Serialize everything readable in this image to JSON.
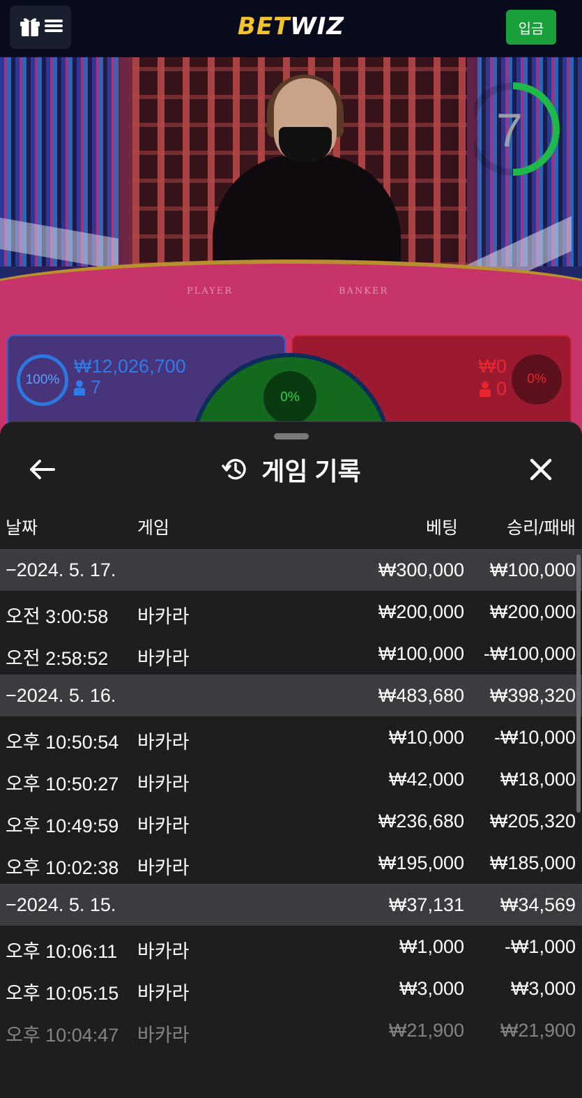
{
  "header": {
    "logo_part1": "BET",
    "logo_part2": "WIZ",
    "deposit_label": "입금",
    "menu_icons": [
      "gift-icon",
      "hamburger-menu-icon"
    ]
  },
  "game": {
    "countdown": "7",
    "player": {
      "percent": "100%",
      "amount": "₩12,026,700",
      "count": "7"
    },
    "tie": {
      "percent": "0%"
    },
    "banker": {
      "percent": "0%",
      "amount": "₩0",
      "count": "0"
    },
    "table_text_left": "PLAYER",
    "table_text_right": "BANKER"
  },
  "history": {
    "title": "게임 기록",
    "columns": {
      "date": "날짜",
      "game": "게임",
      "bet": "베팅",
      "win": "승리/패배"
    },
    "groups": [
      {
        "date": "−2024. 5. 17.",
        "bet": "₩300,000",
        "win": "₩100,000",
        "rows": [
          {
            "time": "오전 3:00:58",
            "game": "바카라",
            "bet": "₩200,000",
            "win": "₩200,000"
          },
          {
            "time": "오전 2:58:52",
            "game": "바카라",
            "bet": "₩100,000",
            "win": "-₩100,000"
          }
        ]
      },
      {
        "date": "−2024. 5. 16.",
        "bet": "₩483,680",
        "win": "₩398,320",
        "rows": [
          {
            "time": "오후 10:50:54",
            "game": "바카라",
            "bet": "₩10,000",
            "win": "-₩10,000"
          },
          {
            "time": "오후 10:50:27",
            "game": "바카라",
            "bet": "₩42,000",
            "win": "₩18,000"
          },
          {
            "time": "오후 10:49:59",
            "game": "바카라",
            "bet": "₩236,680",
            "win": "₩205,320"
          },
          {
            "time": "오후 10:02:38",
            "game": "바카라",
            "bet": "₩195,000",
            "win": "₩185,000"
          }
        ]
      },
      {
        "date": "−2024. 5. 15.",
        "bet": "₩37,131",
        "win": "₩34,569",
        "rows": [
          {
            "time": "오후 10:06:11",
            "game": "바카라",
            "bet": "₩1,000",
            "win": "-₩1,000"
          },
          {
            "time": "오후 10:05:15",
            "game": "바카라",
            "bet": "₩3,000",
            "win": "₩3,000"
          },
          {
            "time": "오후 10:04:47",
            "game": "바카라",
            "bet": "₩21,900",
            "win": "₩21,900"
          }
        ]
      }
    ]
  },
  "colors": {
    "accent_green": "#19a03a",
    "logo_yellow": "#f2c230",
    "player_blue": "#2f7be8",
    "banker_red": "#e8262f",
    "tie_green": "#2fd04a",
    "sheet_bg": "#1e1e20",
    "group_row_bg": "#3c3c40"
  }
}
